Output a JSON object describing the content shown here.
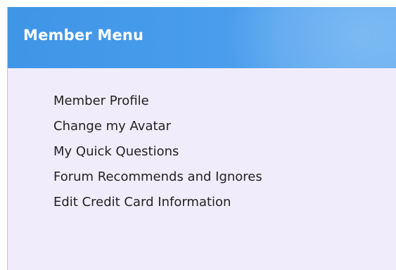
{
  "member_menu": {
    "title": "Member Menu",
    "items": [
      {
        "label": "Member Profile"
      },
      {
        "label": "Change my Avatar"
      },
      {
        "label": "My Quick Questions"
      },
      {
        "label": "Forum Recommends and Ignores"
      },
      {
        "label": "Edit Credit Card Information"
      }
    ]
  },
  "colors": {
    "header_blue": "#4a9ded",
    "panel_background": "#f1ecfb",
    "text": "#222222"
  }
}
